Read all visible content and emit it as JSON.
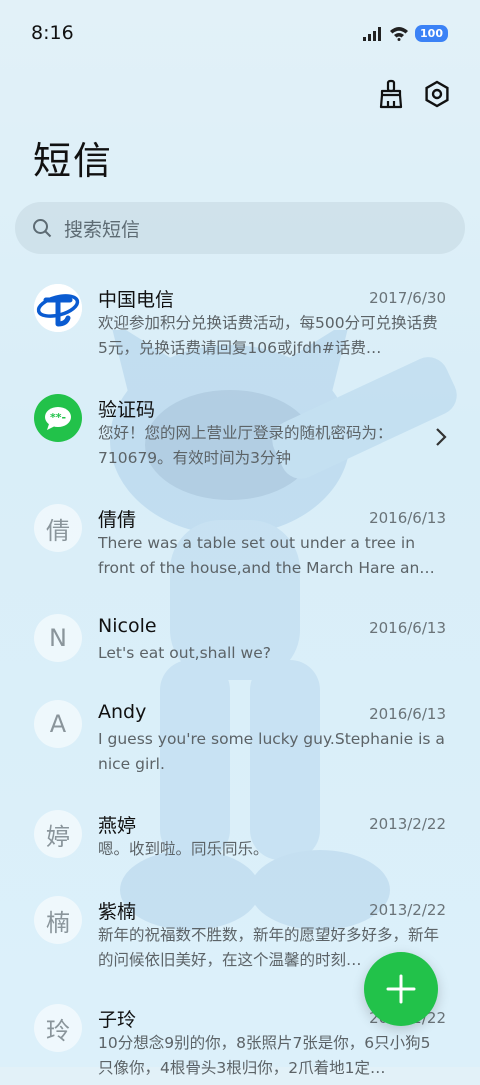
{
  "status_bar": {
    "time": "8:16",
    "battery": "100"
  },
  "header": {
    "title": "短信",
    "clean_icon": "broom-icon",
    "settings_icon": "settings-icon"
  },
  "search": {
    "placeholder": "搜索短信"
  },
  "messages": [
    {
      "name": "中国电信",
      "date": "2017/6/30",
      "preview": "欢迎参加积分兑换话费活动，每500分可兑换话费5元，兑换话费请回复106或jfdh#话费…",
      "avatar": ""
    },
    {
      "name": "验证码",
      "date": "",
      "preview": "您好！您的网上营业厅登录的随机密码为：710679。有效时间为3分钟",
      "avatar": ""
    },
    {
      "name": "倩倩",
      "date": "2016/6/13",
      "preview": "There was a table set out under a tree in front of the house,and the March Hare an…",
      "avatar": "倩"
    },
    {
      "name": "Nicole",
      "date": "2016/6/13",
      "preview": "Let's eat out,shall we?",
      "avatar": "N"
    },
    {
      "name": "Andy",
      "date": "2016/6/13",
      "preview": "I guess you're some lucky guy.Stephanie is a nice girl.",
      "avatar": "A"
    },
    {
      "name": "燕婷",
      "date": "2013/2/22",
      "preview": "嗯。收到啦。同乐同乐。",
      "avatar": "婷"
    },
    {
      "name": "紫楠",
      "date": "2013/2/22",
      "preview": "新年的祝福数不胜数，新年的愿望好多好多，新年的问候依旧美好，在这个温馨的时刻…",
      "avatar": "楠"
    },
    {
      "name": "子玲",
      "date": "2013/2/22",
      "preview": "10分想念9别的你，8张照片7张是你，6只小狗5只像你，4根骨头3根归你，2爪着地1定…",
      "avatar": "玲"
    }
  ],
  "colors": {
    "accent_green": "#22c24a",
    "telecom_blue": "#0a5bd1",
    "battery_blue": "#3b82f6"
  },
  "fab": {
    "icon": "plus-icon"
  }
}
